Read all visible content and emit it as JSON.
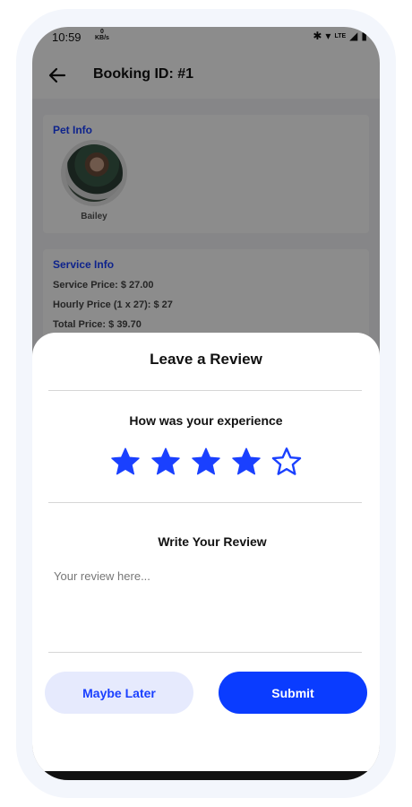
{
  "status_bar": {
    "time": "10:59",
    "kbs_value": "0",
    "kbs_unit": "KB/s",
    "network": "LTE"
  },
  "app_bar": {
    "title": "Booking ID: #1"
  },
  "pet_info": {
    "title": "Pet Info",
    "pet_name": "Bailey"
  },
  "service_info": {
    "title": "Service Info",
    "service_price": "Service Price: $ 27.00",
    "hourly_price": "Hourly Price (1 x 27): $ 27",
    "total_price": "Total Price: $ 39.70"
  },
  "review_sheet": {
    "title": "Leave a Review",
    "question": "How was your experience",
    "rating": 4,
    "rating_max": 5,
    "write_label": "Write Your Review",
    "review_placeholder": "Your review here...",
    "review_value": "",
    "maybe_later_label": "Maybe Later",
    "submit_label": "Submit"
  },
  "colors": {
    "accent": "#0a3cff",
    "accent_light": "#e6eafd",
    "star": "#1a40ff"
  },
  "icons": {
    "back": "arrow-left-icon",
    "star_filled": "star-filled-icon",
    "star_empty": "star-outline-icon"
  }
}
